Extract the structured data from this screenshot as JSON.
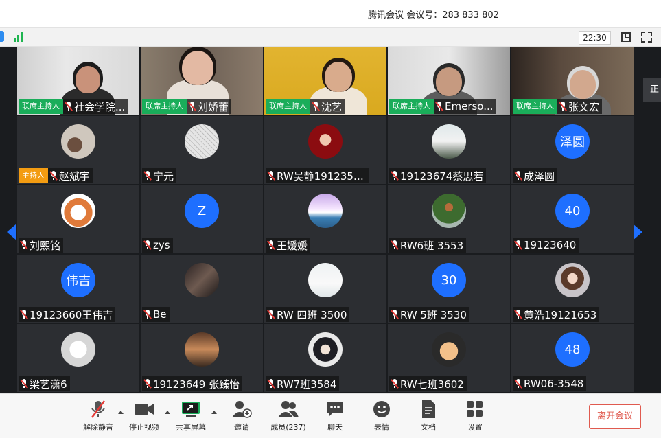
{
  "window": {
    "title": "腾讯会议  会议号：283 833 802"
  },
  "status": {
    "timer": "22:30",
    "signal_icon": "signal-bars-icon",
    "side_chip_label": "正"
  },
  "participants": [
    {
      "name": "社会学院...",
      "badge": "联席主持人",
      "video": true
    },
    {
      "name": "刘娇蕾",
      "badge": "联席主持人",
      "video": true
    },
    {
      "name": "沈艺",
      "badge": "联席主持人",
      "video": true
    },
    {
      "name": "Emerso...",
      "badge": "联席主持人",
      "video": true
    },
    {
      "name": "张文宏",
      "badge": "联席主持人",
      "video": true
    },
    {
      "name": "赵斌宇",
      "badge": "主持人",
      "avatar": "sketch-photo"
    },
    {
      "name": "宁元",
      "avatar": "line-art"
    },
    {
      "name": "RW吴静19123551",
      "avatar": "red-portrait"
    },
    {
      "name": "19123674蔡思若",
      "avatar": "street-photo"
    },
    {
      "name": "成泽圆",
      "avatar_text": "泽圆"
    },
    {
      "name": "刘熙铭",
      "avatar": "cartoon-panda"
    },
    {
      "name": "zys",
      "avatar_text": "Z"
    },
    {
      "name": "王媛媛",
      "avatar": "snow-mountain"
    },
    {
      "name": "RW6班 3553",
      "avatar": "tree-landscape"
    },
    {
      "name": "19123640",
      "avatar_text": "40"
    },
    {
      "name": "19123660王伟吉",
      "avatar_text": "伟吉"
    },
    {
      "name": "Be",
      "avatar": "dark-portrait"
    },
    {
      "name": "RW 四班 3500",
      "avatar": "white-room"
    },
    {
      "name": "RW 5班 3530",
      "avatar_text": "30"
    },
    {
      "name": "黄浩19121653",
      "avatar": "anime-girl"
    },
    {
      "name": "梁艺潇6",
      "avatar": "white-figure"
    },
    {
      "name": "19123649 张臻怡",
      "avatar": "cafe-photo"
    },
    {
      "name": "RW7班3584",
      "avatar": "anime-boy"
    },
    {
      "name": "RW七班3602",
      "avatar": "cat-photo"
    },
    {
      "name": "RW06-3548",
      "avatar_text": "48"
    }
  ],
  "toolbar": {
    "mute": "解除静音",
    "video": "停止视频",
    "share": "共享屏幕",
    "invite": "邀请",
    "members": "成员(237)",
    "chat": "聊天",
    "emoji": "表情",
    "docs": "文档",
    "settings": "设置",
    "leave": "离开会议"
  },
  "colors": {
    "cohost": "#1aad5a",
    "host": "#f39c12",
    "accent": "#1e6fff",
    "leave": "#e05a4f"
  }
}
